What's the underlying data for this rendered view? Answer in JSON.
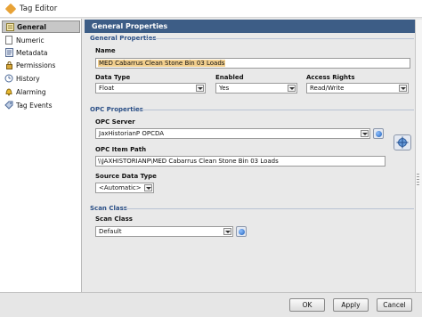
{
  "window": {
    "title": "Tag Editor"
  },
  "sidebar": {
    "items": [
      {
        "label": "General",
        "icon": "general-icon"
      },
      {
        "label": "Numeric",
        "icon": "page-icon"
      },
      {
        "label": "Metadata",
        "icon": "metadata-icon"
      },
      {
        "label": "Permissions",
        "icon": "permissions-icon"
      },
      {
        "label": "History",
        "icon": "history-icon"
      },
      {
        "label": "Alarming",
        "icon": "alarm-bell-icon"
      },
      {
        "label": "Tag Events",
        "icon": "tag-events-icon"
      }
    ],
    "selected": "General"
  },
  "panel": {
    "header": "General Properties",
    "general_section": {
      "title": "General Properties",
      "name_label": "Name",
      "name_value": "MED Cabarrus Clean Stone Bin 03 Loads",
      "data_type_label": "Data Type",
      "data_type_value": "Float",
      "enabled_label": "Enabled",
      "enabled_value": "Yes",
      "access_rights_label": "Access Rights",
      "access_rights_value": "Read/Write"
    },
    "opc_section": {
      "title": "OPC Properties",
      "server_label": "OPC Server",
      "server_value": "JaxHistorianP OPCDA",
      "item_path_label": "OPC Item Path",
      "item_path_value": "\\\\JAXHISTORIANP\\MED Cabarrus Clean Stone Bin 03 Loads",
      "source_type_label": "Source Data Type",
      "source_type_value": "<Automatic>"
    },
    "scan_section": {
      "title": "Scan Class",
      "scan_class_label": "Scan Class",
      "scan_class_value": "Default"
    }
  },
  "buttons": {
    "ok": "OK",
    "apply": "Apply",
    "cancel": "Cancel"
  },
  "colors": {
    "header_bg": "#3d5d86",
    "section_title": "#2b4f86",
    "name_highlight": "#f2cf8e"
  }
}
